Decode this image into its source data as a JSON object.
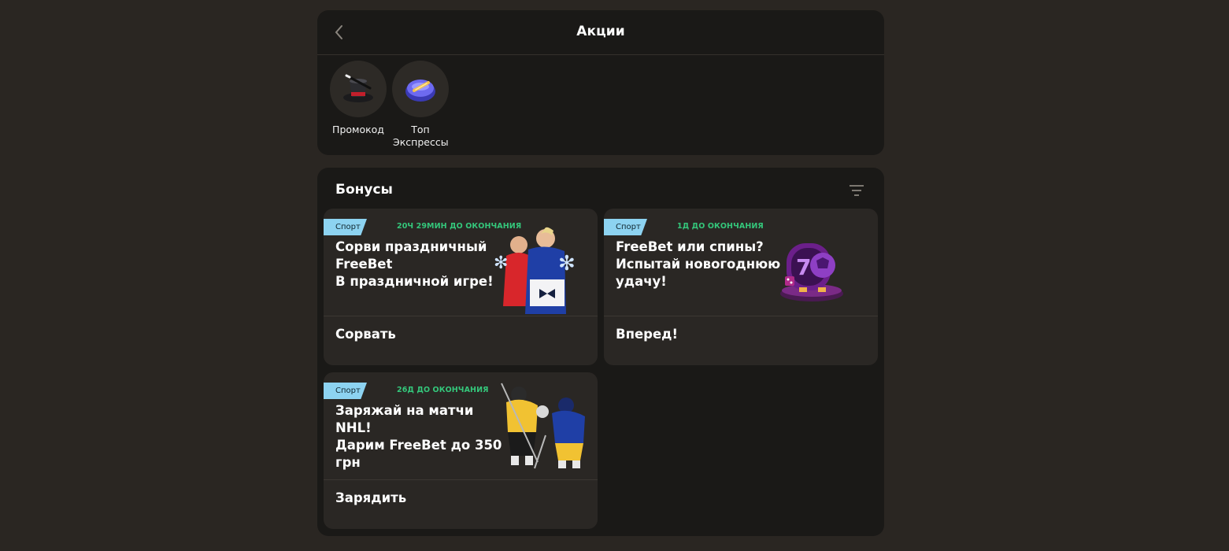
{
  "header": {
    "title": "Акции"
  },
  "quick_links": [
    {
      "label": "Промокод",
      "icon": "magic-hat-icon"
    },
    {
      "label": "Топ Экспрессы",
      "icon": "rocket-disc-icon"
    }
  ],
  "bonuses": {
    "title": "Бонусы",
    "cards": [
      {
        "tag": "Спорт",
        "timer": "20Ч 29МИН ДО ОКОНЧАНИЯ",
        "title_lines": [
          "Сорви праздничный",
          "FreeBet",
          "В праздничной игре!"
        ],
        "action": "Сорвать",
        "image": "football-players-gift-image"
      },
      {
        "tag": "Спорт",
        "timer": "1Д ДО ОКОНЧАНИЯ",
        "title_lines": [
          "FreeBet или спины?",
          "Испытай новогоднюю",
          "удачу!"
        ],
        "action": "Вперед!",
        "image": "slot-machine-ball-image"
      },
      {
        "tag": "Спорт",
        "timer": "26Д ДО ОКОНЧАНИЯ",
        "title_lines": [
          "Заряжай на матчи",
          "NHL!",
          "Дарим FreeBet до 350",
          "грн"
        ],
        "action": "Зарядить",
        "image": "hockey-players-image"
      }
    ]
  },
  "colors": {
    "page_bg": "#2a2622",
    "panel_bg": "#1a1917",
    "card_bg": "#2a2724",
    "tag_bg": "#8dd3f1",
    "timer": "#34c77b"
  }
}
